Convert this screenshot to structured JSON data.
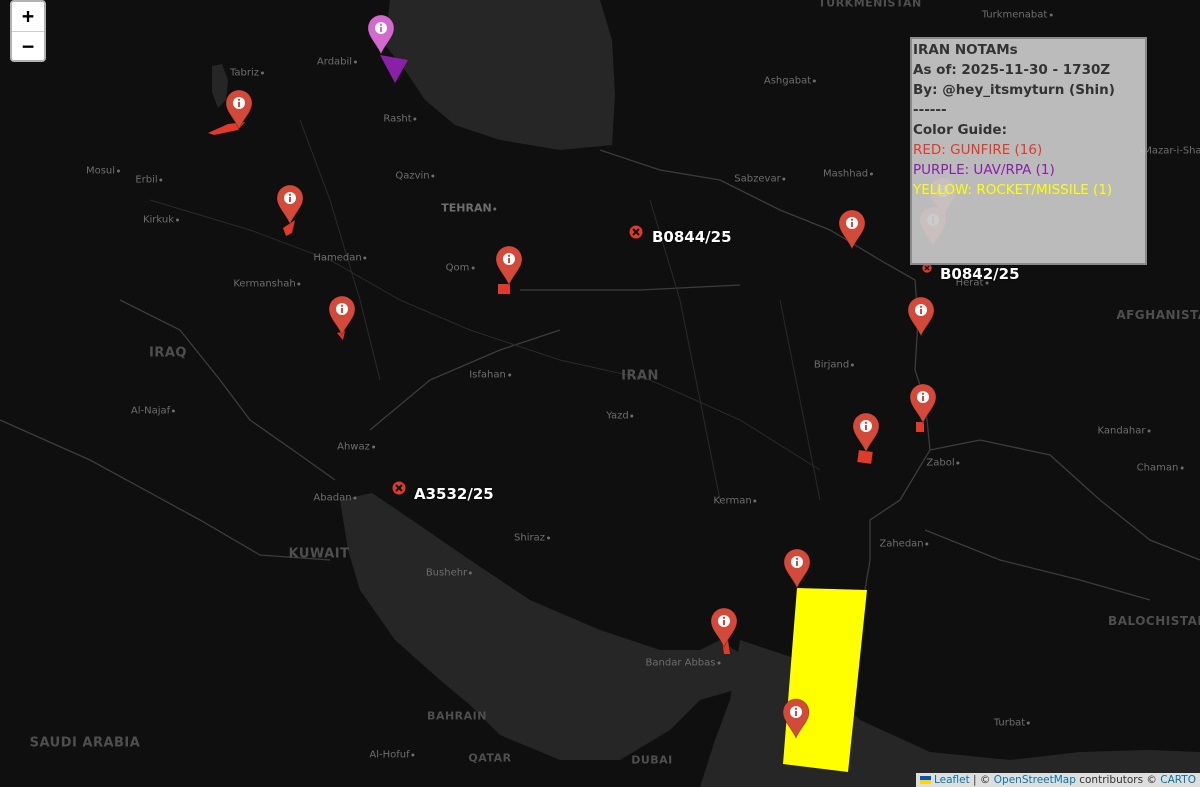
{
  "zoom": {
    "in_label": "+",
    "out_label": "−"
  },
  "legend": {
    "title": "IRAN NOTAMs",
    "as_of": "As of: 2025-11-30 - 1730Z",
    "by": "By: @hey_itsmyturn (Shin)",
    "divider": "------",
    "guide_title": "Color Guide:",
    "red": "RED: GUNFIRE (16)",
    "purple": "PURPLE: UAV/RPA (1)",
    "yellow": "YELLOW: ROCKET/MISSILE (1)"
  },
  "colors": {
    "gunfire": "#e03a2a",
    "uav": "#8a1fa8",
    "rocket": "#ffff00",
    "marker_red": "#d44a3a",
    "marker_purple": "#d36ad0"
  },
  "notam_labels": {
    "b0844": "B0844/25",
    "b0842": "B0842/25",
    "a3532": "A3532/25"
  },
  "countries": {
    "iraq": "IRAQ",
    "iran": "IRAN",
    "kuwait": "KUWAIT",
    "saudi": "SAUDI ARABIA",
    "bahrain": "BAHRAIN",
    "qatar": "QATAR",
    "dubai": "DUBAI",
    "afghanistan": "AFGHANISTA",
    "balochistan": "BALOCHISTAN",
    "turkmenistan": "TURKMENISTAN"
  },
  "cities": {
    "tabriz": "Tabriz",
    "ardabil": "Ardabil",
    "rasht": "Rasht",
    "mosul": "Mosul",
    "erbil": "Erbil",
    "kirkuk": "Kirkuk",
    "qazvin": "Qazvin",
    "tehran": "TEHRAN",
    "hamedan": "Hamedan",
    "kermanshah": "Kermanshah",
    "qom": "Qom",
    "isfahan": "Isfahan",
    "yazd": "Yazd",
    "alnajaf": "Al-Najaf",
    "ahwaz": "Ahwaz",
    "abadan": "Abadan",
    "shiraz": "Shiraz",
    "bushehr": "Bushehr",
    "kerman": "Kerman",
    "bandarabbas": "Bandar Abbas",
    "alhofuf": "Al-Hofuf",
    "birjand": "Birjand",
    "mashhad": "Mashhad",
    "sabzevar": "Sabzevar",
    "ashgabat": "Ashgabat",
    "turkmenabat": "Turkmenabat",
    "herat": "Herat",
    "mazar": "Mazar-i-Shar",
    "zabol": "Zabol",
    "zahedan": "Zahedan",
    "kandahar": "Kandahar",
    "chaman": "Chaman",
    "turbat": "Turbat"
  },
  "attribution": {
    "leaflet": "Leaflet",
    "sep": " | © ",
    "osm": "OpenStreetMap",
    "contributors": " contributors © ",
    "carto": "CARTO"
  }
}
